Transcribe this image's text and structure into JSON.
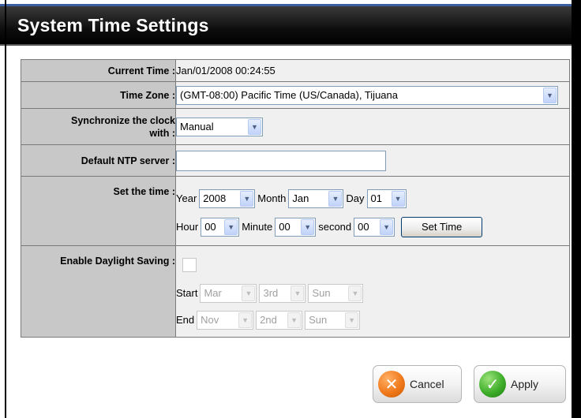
{
  "window": {
    "title": "System Time Settings"
  },
  "rows": {
    "current_time": {
      "label": "Current Time :",
      "value": "Jan/01/2008 00:24:55"
    },
    "time_zone": {
      "label": "Time Zone :",
      "selected": "(GMT-08:00) Pacific Time (US/Canada), Tijuana"
    },
    "sync": {
      "label_line1": "Synchronize the clock",
      "label_line2": "with :",
      "selected": "Manual"
    },
    "ntp": {
      "label": "Default NTP server :",
      "value": ""
    },
    "set_time": {
      "label": "Set the time :",
      "year_label": "Year",
      "year": "2008",
      "month_label": "Month",
      "month": "Jan",
      "day_label": "Day",
      "day": "01",
      "hour_label": "Hour",
      "hour": "00",
      "minute_label": "Minute",
      "minute": "00",
      "second_label": "second",
      "second": "00",
      "button": "Set Time"
    },
    "daylight": {
      "label": "Enable Daylight Saving :",
      "checked": false,
      "start_label": "Start",
      "start_month": "Mar",
      "start_week": "3rd",
      "start_day": "Sun",
      "end_label": "End",
      "end_month": "Nov",
      "end_week": "2nd",
      "end_day": "Sun"
    }
  },
  "buttons": {
    "cancel": "Cancel",
    "apply": "Apply"
  },
  "colors": {
    "label_bg": "#c8c8c8",
    "value_bg": "#f0f0f0",
    "cancel_icon": "#f07a1c",
    "apply_icon": "#3fae2a"
  },
  "icons": {
    "cancel": "x-circle-icon",
    "apply": "checkmark-circle-icon",
    "dropdown": "chevron-down-icon"
  }
}
